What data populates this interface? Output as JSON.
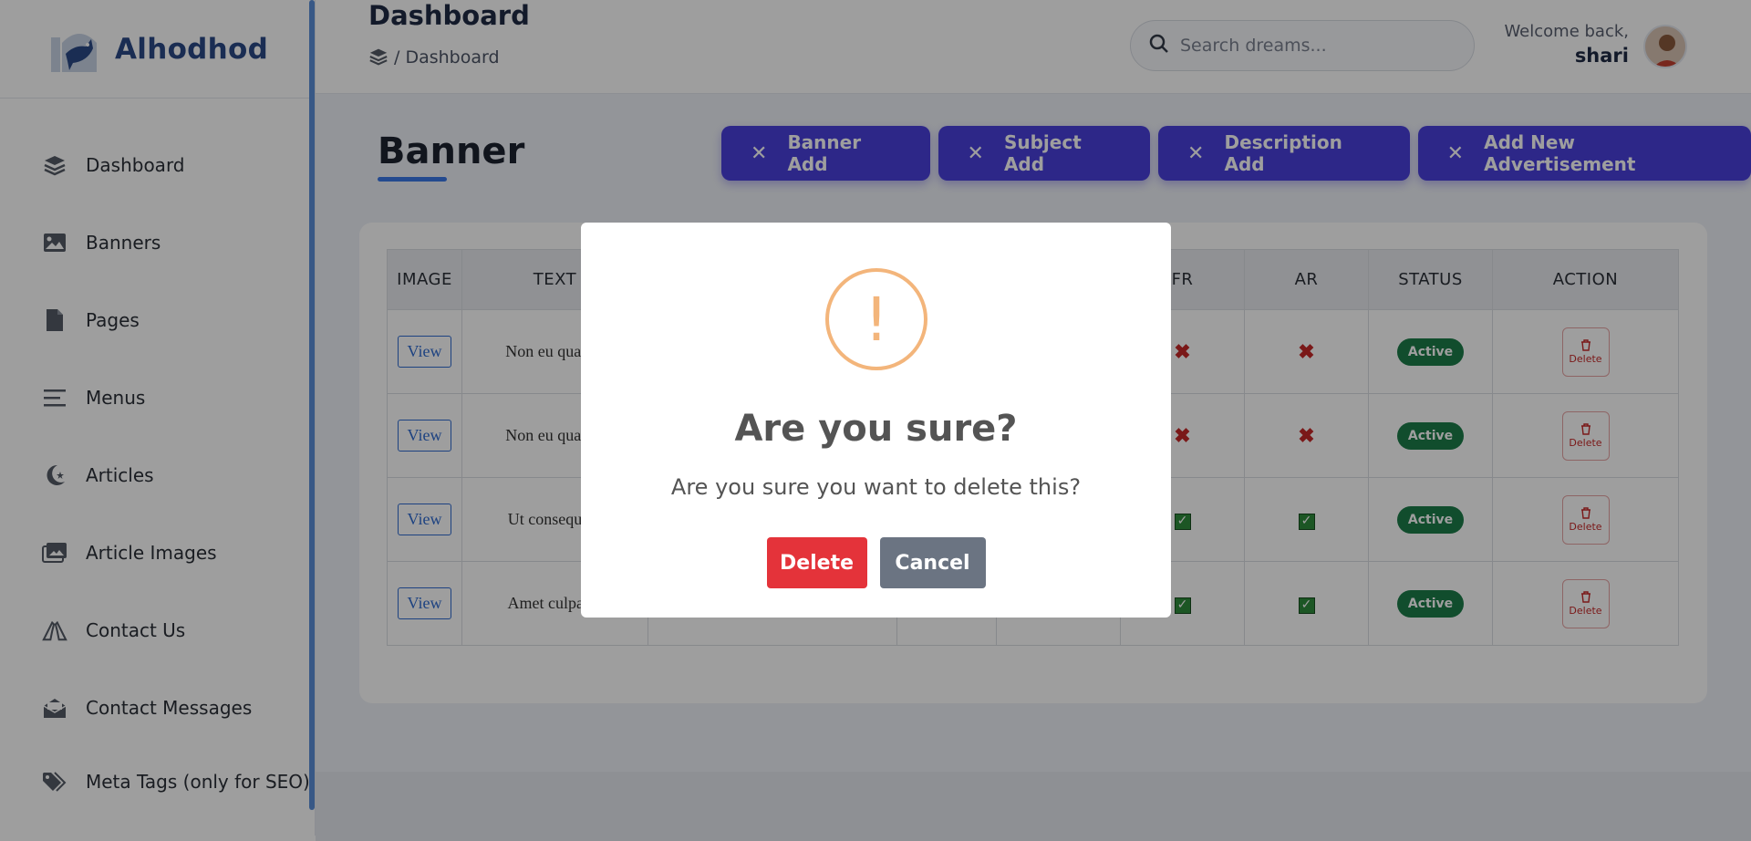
{
  "brand": {
    "name": "Alhodhod"
  },
  "sidebar": {
    "items": [
      {
        "label": "Dashboard",
        "icon": "layers-icon"
      },
      {
        "label": "Banners",
        "icon": "image-icon"
      },
      {
        "label": "Pages",
        "icon": "file-icon"
      },
      {
        "label": "Menus",
        "icon": "menu-icon"
      },
      {
        "label": "Articles",
        "icon": "crescent-star-icon"
      },
      {
        "label": "Article Images",
        "icon": "images-icon"
      },
      {
        "label": "Contact Us",
        "icon": "hands-icon"
      },
      {
        "label": "Contact Messages",
        "icon": "envelope-open-icon"
      },
      {
        "label": "Meta Tags (only for SEO)",
        "icon": "tags-icon"
      }
    ]
  },
  "header": {
    "title": "Dashboard",
    "breadcrumb": "/ Dashboard",
    "search_placeholder": "Search dreams...",
    "welcome": "Welcome back,",
    "username": "shari"
  },
  "main": {
    "section_title": "Banner",
    "buttons": [
      "Banner Add",
      "Subject Add",
      "Description Add",
      "Add New Advertisement"
    ]
  },
  "table": {
    "headers": [
      "IMAGE",
      "TEXT",
      "",
      "",
      "",
      "FR",
      "AR",
      "STATUS",
      "ACTION"
    ],
    "rows": [
      {
        "view": "View",
        "text": "Non eu quasi v",
        "fr": "x",
        "ar": "x",
        "status": "Active",
        "action": "Delete"
      },
      {
        "view": "View",
        "text": "Non eu quasi v",
        "fr": "x",
        "ar": "x",
        "status": "Active",
        "action": "Delete"
      },
      {
        "view": "View",
        "text": "Ut consequatu",
        "fr": "check",
        "ar": "check",
        "status": "Active",
        "action": "Delete"
      },
      {
        "view": "View",
        "text": "Amet culpa ac",
        "fr": "check",
        "ar": "check",
        "status": "Active",
        "action": "Delete"
      }
    ]
  },
  "modal": {
    "icon": "!",
    "title": "Are you sure?",
    "text": "Are you sure you want to delete this?",
    "confirm": "Delete",
    "cancel": "Cancel"
  },
  "colors": {
    "primary_button": "#4a3fdb",
    "status_active": "#1c7c4a",
    "danger": "#e4333a",
    "cancel": "#6b7482",
    "warning": "#f3b57b",
    "brand_text": "#2a4a86"
  }
}
